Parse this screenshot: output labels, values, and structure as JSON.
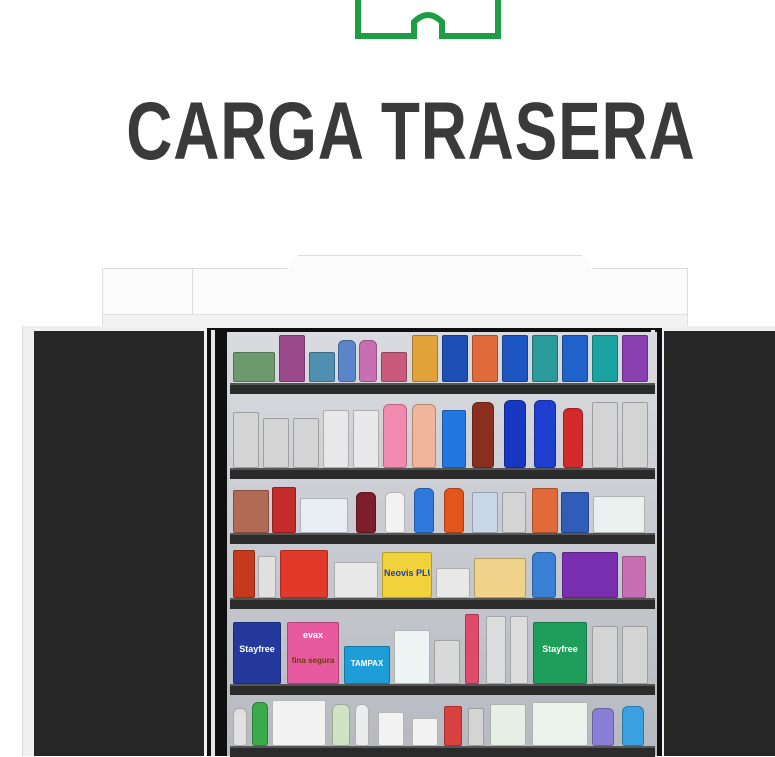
{
  "title": "CARGA TRASERA",
  "colors": {
    "logo": "#1f9d45",
    "title": "#3a3a3a",
    "panels": "#262626"
  },
  "brands": {
    "stayfree_1": "Stayfree",
    "evax": "evax",
    "fina_segura": "fina segura",
    "tampax": "TAMPAX",
    "stayfree_2": "Stayfree",
    "neovis": "Neovis PLUS"
  }
}
